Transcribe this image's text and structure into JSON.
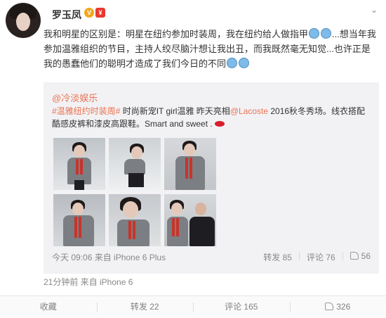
{
  "user": {
    "name": "罗玉凤",
    "vip_badge": "V",
    "red_badge": "¥",
    "menu_arrow": "⌄"
  },
  "post": {
    "text_parts": [
      "我和明星的区别是：明星在纽约参加时装周，我在纽约给人做指甲",
      "...想当年我参加温雅组织的节目，主持人绞尽脑汁想让我出丑，而我既然毫无知觉...也许正是我的愚蠢他们的聪明才造成了我们今日的不同"
    ],
    "time_source": "21分钟前 来自 iPhone 6"
  },
  "repost": {
    "original_user": "@冷淡娱乐",
    "tag": "#温雅纽约时装周#",
    "text_a": " 时尚新宠IT girl温雅 昨天亮相",
    "mention": "@Lacoste",
    "text_b": " 2016秋冬秀场。线衣搭配酷感皮裤和漆皮高跟鞋。Smart and sweet .",
    "time_source": "今天 09:06 来自 iPhone 6 Plus",
    "repost_label": "转发 85",
    "comment_label": "评论 76",
    "like_label": "56"
  },
  "footer": {
    "favorite": "收藏",
    "repost": "转发 22",
    "comment": "评论 165",
    "like": "326"
  },
  "colors": {
    "link": "#eb7350",
    "meta": "#888888",
    "repost_bg": "#f2f2f5"
  },
  "icons": [
    "vip-icon",
    "emoji-icon",
    "lips-icon",
    "repost-icon",
    "comment-icon",
    "like-icon"
  ]
}
